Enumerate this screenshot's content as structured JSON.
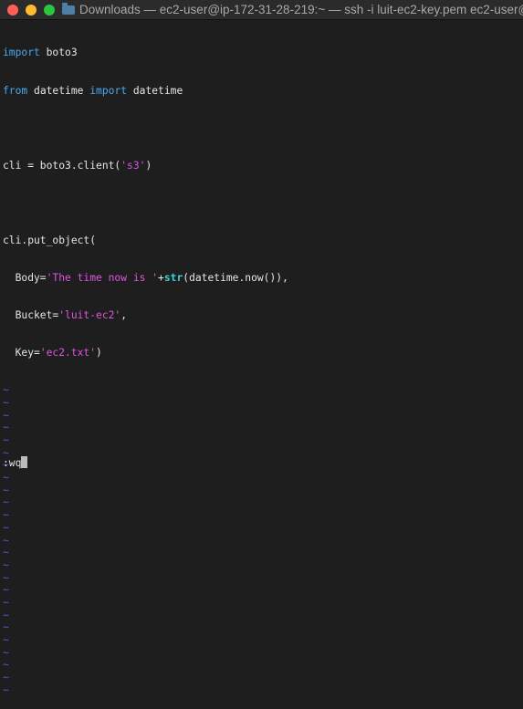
{
  "window": {
    "title": "Downloads — ec2-user@ip-172-31-28-219:~ — ssh -i luit-ec2-key.pem ec2-user@",
    "colors": {
      "background": "#1e1e1e",
      "keyword": "#4aa9f0",
      "string": "#e154e1",
      "builtin": "#3ad4d4",
      "tilde": "#4a5cd6"
    }
  },
  "editor": {
    "line1": {
      "kw": "import",
      "rest": " boto3"
    },
    "line2": {
      "kw1": "from",
      "mid": " datetime ",
      "kw2": "import",
      "rest": " datetime"
    },
    "line4": {
      "a": "cli = boto3.client(",
      "s": "'s3'",
      "b": ")"
    },
    "line6": {
      "text": "cli.put_object("
    },
    "line7": {
      "a": "  Body=",
      "s": "'The time now is '",
      "b": "+",
      "bi": "str",
      "c": "(datetime.now()),"
    },
    "line8": {
      "a": "  Bucket=",
      "s": "'luit-ec2'",
      "b": ","
    },
    "line9": {
      "a": "  Key=",
      "s": "'ec2.txt'",
      "b": ")"
    },
    "tilde": "~"
  },
  "command_line": {
    "text": ":wq"
  }
}
